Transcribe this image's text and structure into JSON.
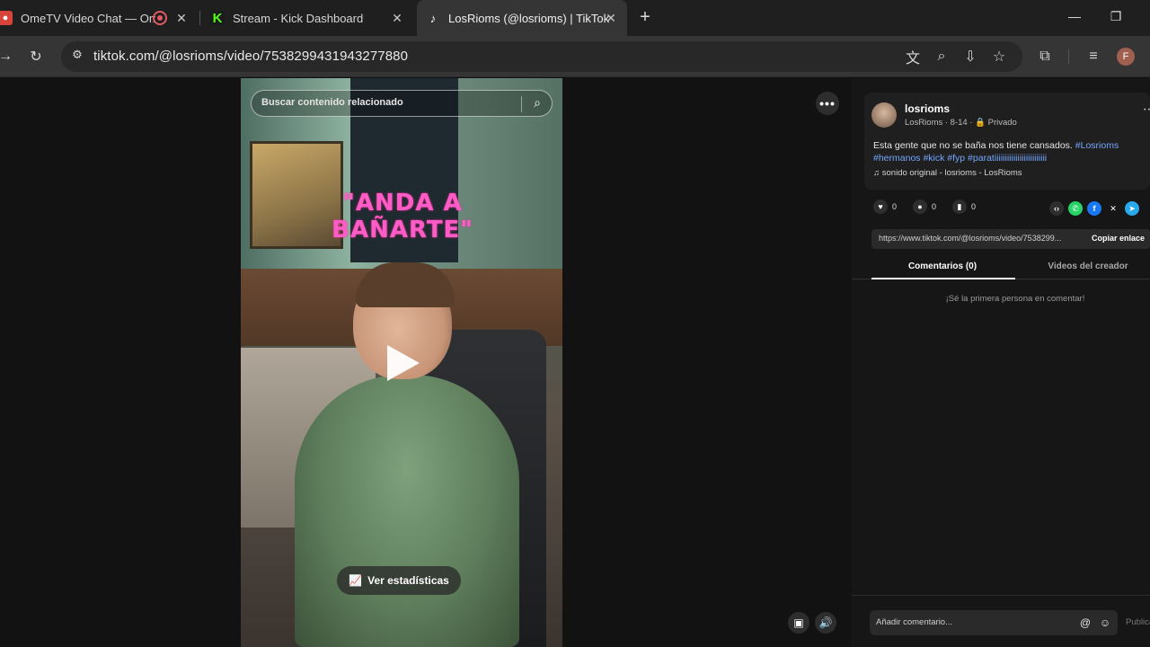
{
  "tabs": [
    {
      "title": "OmeTV Video Chat — Ome",
      "icon": "ometv-icon",
      "active": false
    },
    {
      "title": "Stream - Kick Dashboard",
      "icon": "kick-icon",
      "active": false
    },
    {
      "title": "LosRioms (@losrioms) | TikTok",
      "icon": "tiktok-icon",
      "active": true
    }
  ],
  "toolbar": {
    "url": "tiktok.com/@losrioms/video/7538299431943277880",
    "profile_initial": "F"
  },
  "video": {
    "search_placeholder": "Buscar contenido relacionado",
    "overlay_text": "\"ANDA A BAÑARTE\"",
    "stats_label": "Ver estadísticas"
  },
  "post": {
    "username": "losrioms",
    "meta": "LosRioms · 8-14 · 🔒 Privado",
    "description_text": "Esta gente que no se baña nos tiene cansados. ",
    "hashtags_1": "#Losrioms",
    "hashtags_2": "#hermanos #kick #fyp #paratiiiiiiiiiiiiiiiiiiiiiiiii",
    "sound": "♫  sonido original - losrioms - LosRioms",
    "likes": "0",
    "comments": "0",
    "saves": "0",
    "link": "https://www.tiktok.com/@losrioms/video/7538299...",
    "copy_label": "Copiar enlace"
  },
  "panel_tabs": {
    "comments": "Comentarios (0)",
    "creator_videos": "Videos del creador"
  },
  "comments": {
    "empty": "¡Sé la primera persona en comentar!",
    "input_placeholder": "Añadir comentario...",
    "post_label": "Publicar"
  },
  "colors": {
    "background": "#121212",
    "hashtag": "#74a7ff",
    "overlay_text": "#ff5cc8"
  }
}
